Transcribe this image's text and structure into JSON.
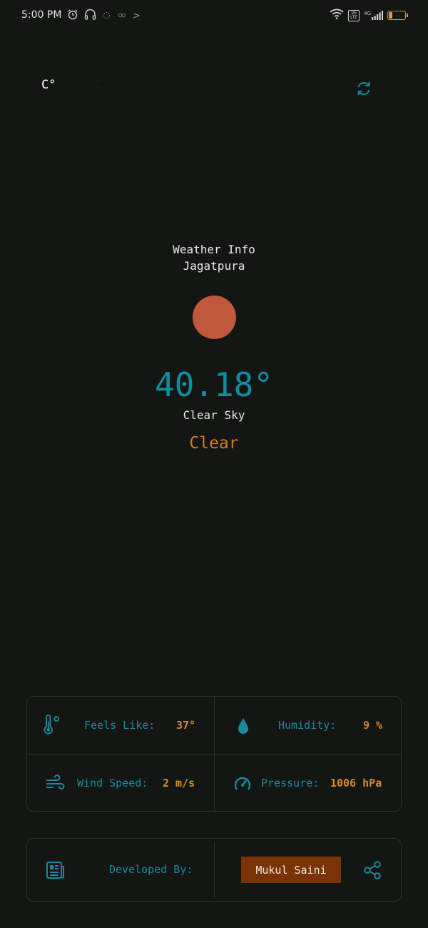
{
  "status_bar": {
    "time": "5:00 PM",
    "network_label": "4G",
    "lte_label": "Vo LTE",
    "battery": "29",
    "battery_level": 0.29,
    "left_icons": [
      "alarm-icon",
      "headphones-icon",
      "sync-status-icon",
      "loading-status-icon"
    ],
    "right_icons": [
      "wifi-icon",
      "lte-icon",
      "signal-icon",
      "battery-icon"
    ],
    "more_chevron": ">"
  },
  "controls": {
    "unit_label": "C°",
    "refresh_icon": "refresh-icon"
  },
  "weather": {
    "heading": "Weather Info",
    "city": "Jagatpura",
    "temperature": "40.18°",
    "description": "Clear Sky",
    "main": "Clear",
    "sun_color": "#c0583c"
  },
  "details": {
    "feels_like_label": "Feels Like:",
    "feels_like_value": "37°",
    "humidity_label": "Humidity:",
    "humidity_value": "9 %",
    "wind_label": "Wind Speed:",
    "wind_value": "2 m/s",
    "pressure_label": "Pressure:",
    "pressure_value": "1006 hPa"
  },
  "developer": {
    "label": "Developed By:",
    "name": "Mukul Saini",
    "icons": [
      "news-icon",
      "share-icon"
    ]
  },
  "colors": {
    "background": "#141614",
    "accent_teal": "#108da0",
    "accent_orange": "#d27a22",
    "developer_button": "#7a3207",
    "card_border": "#2c2f2d"
  }
}
